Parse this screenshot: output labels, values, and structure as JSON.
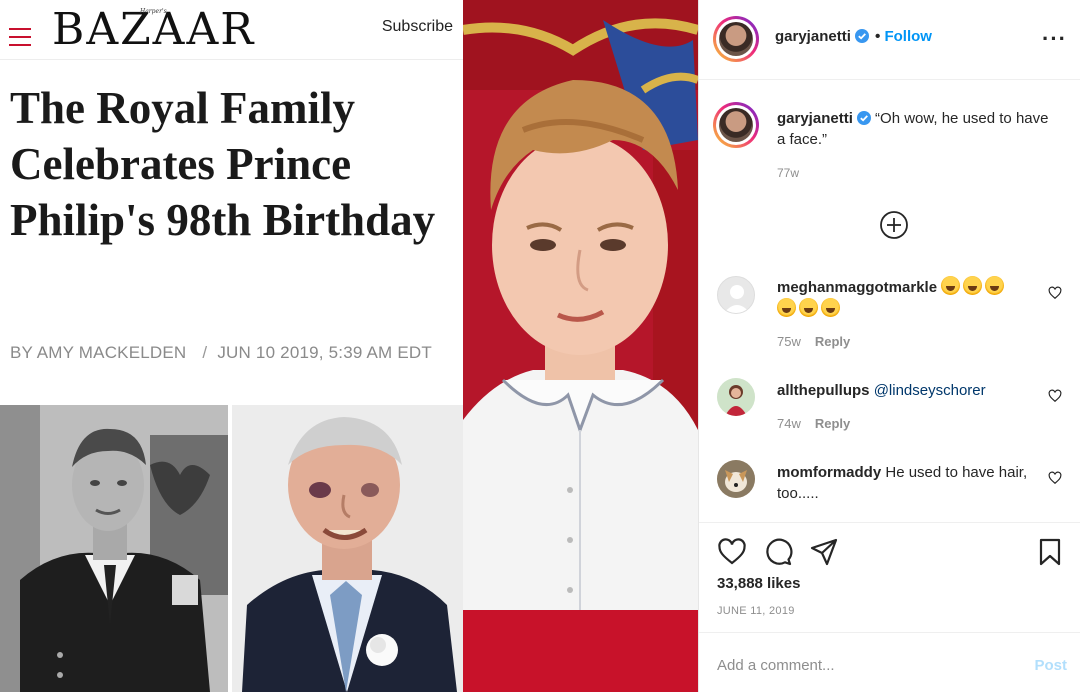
{
  "article": {
    "brand": "BAZAAR",
    "brand_small": "Harper's",
    "subscribe": "Subscribe",
    "headline": "The Royal Family Celebrates Prince Philip's 98th Birthday",
    "byline_author": "BY AMY MACKELDEN",
    "byline_date": "JUN 10 2019, 5:39 AM EDT"
  },
  "instagram": {
    "username": "garyjanetti",
    "follow": "Follow",
    "more": "···",
    "caption": "“Oh wow, he used to have a face.”",
    "caption_time": "77w",
    "comments": [
      {
        "user": "meghanmaggotmarkle",
        "text": "",
        "time": "75w",
        "reply": "Reply"
      },
      {
        "user": "allthepullups",
        "text": "@lindseyschorer",
        "time": "74w",
        "reply": "Reply"
      },
      {
        "user": "momformaddy",
        "text": "He used to have hair, too.....",
        "time": "",
        "reply": ""
      }
    ],
    "likes": "33,888 likes",
    "date": "JUNE 11, 2019",
    "add_comment_placeholder": "Add a comment...",
    "post": "Post",
    "colors": {
      "link": "#0095f6",
      "muted": "#8e8e8e",
      "post_disabled": "#b2dffc",
      "brand_red": "#c8102e"
    }
  }
}
